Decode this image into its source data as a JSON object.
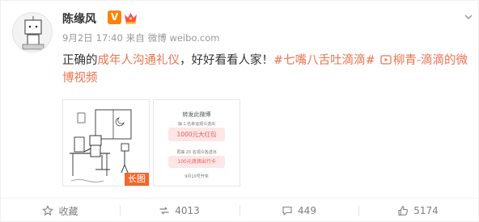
{
  "user": {
    "name": "陈缘风",
    "verified_badge": "V"
  },
  "meta": {
    "date": "9月2日",
    "time": "17:40",
    "from_label": "来自",
    "source": "微博 weibo.com"
  },
  "post": {
    "text_start": "正确的",
    "highlight": "成年人沟通礼仪",
    "text_mid": "，好好看看人家！",
    "hashtag": "#七嘴八舌吐滴滴#",
    "video_link": "柳青-滴滴的微博视频"
  },
  "thumbnails": {
    "long_image_badge": "长图",
    "poster": {
      "title": "转发此微博",
      "line1": "抽 1 名幸运观众送出",
      "prize1": "1000元大红包",
      "line2": "再抽 20 名观众各送出",
      "prize2": "100元滴滴出行卡",
      "date": "9月10号开奖"
    }
  },
  "actions": {
    "favorite": "收藏",
    "repost": "4013",
    "comment": "449",
    "like": "5174"
  },
  "colors": {
    "accent": "#eb7350",
    "verified": "#ff8200",
    "muted": "#808080"
  }
}
